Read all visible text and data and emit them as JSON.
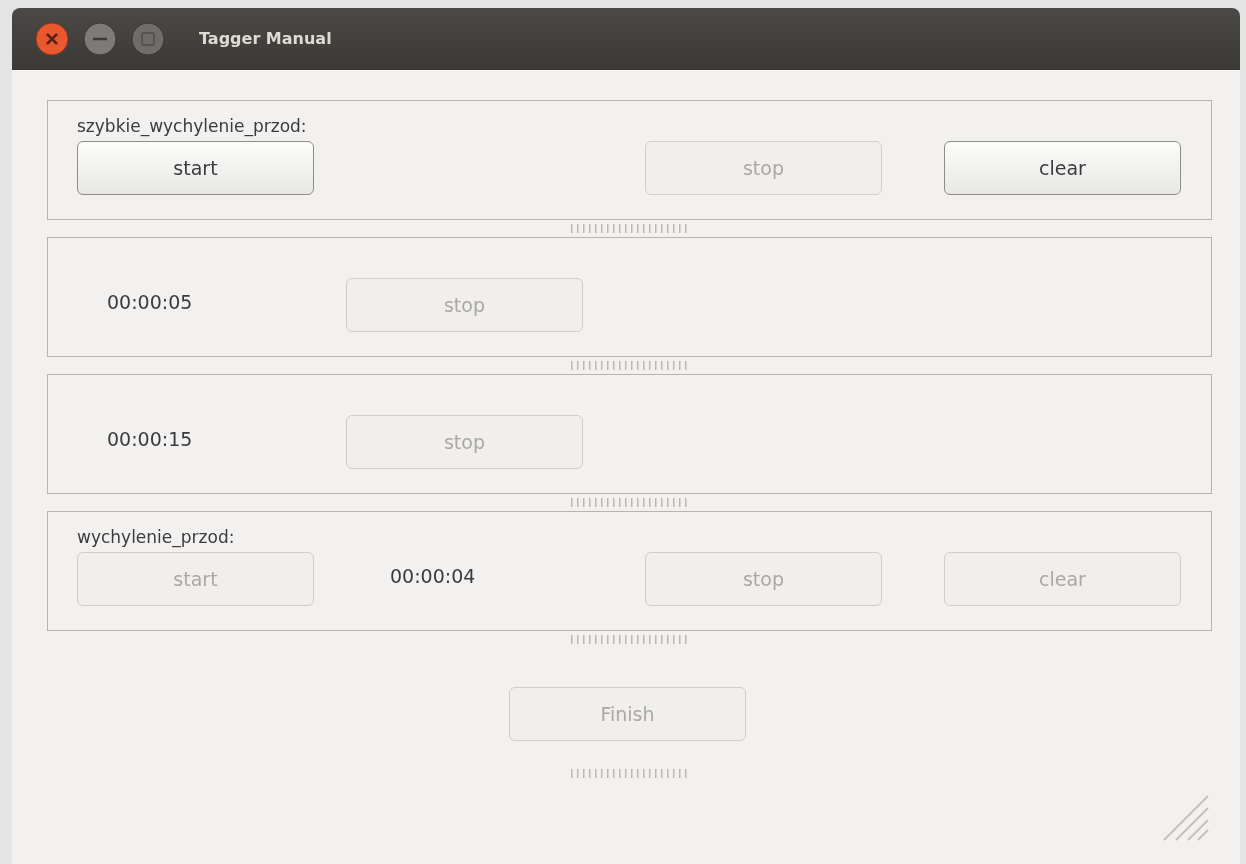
{
  "window": {
    "title": "Tagger Manual"
  },
  "panels": [
    {
      "label": "szybkie_wychylenie_przod:",
      "items": [
        {
          "kind": "start",
          "text": "start",
          "disabled": false
        },
        {
          "kind": "stop",
          "text": "stop",
          "disabled": true
        },
        {
          "kind": "clear",
          "text": "clear",
          "disabled": false
        }
      ]
    },
    {
      "items": [
        {
          "kind": "timer",
          "text": "00:00:05"
        },
        {
          "kind": "stop",
          "text": "stop",
          "disabled": true
        }
      ]
    },
    {
      "items": [
        {
          "kind": "timer",
          "text": "00:00:15"
        },
        {
          "kind": "stop",
          "text": "stop",
          "disabled": true
        }
      ]
    },
    {
      "label": "wychylenie_przod:",
      "items": [
        {
          "kind": "start",
          "text": "start",
          "disabled": true
        },
        {
          "kind": "timer",
          "text": "00:00:04"
        },
        {
          "kind": "stop",
          "text": "stop",
          "disabled": true
        },
        {
          "kind": "clear",
          "text": "clear",
          "disabled": true
        }
      ]
    }
  ],
  "finish_button": {
    "text": "Finish",
    "disabled": true
  }
}
